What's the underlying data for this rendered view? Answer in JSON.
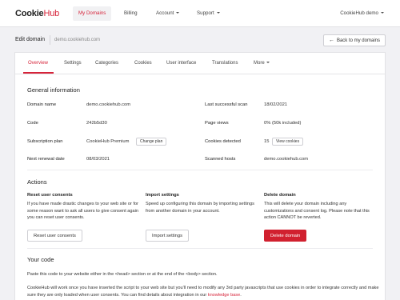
{
  "brand": {
    "part1": "Cookie",
    "part2": "Hub"
  },
  "nav": {
    "my_domains": "My Domains",
    "billing": "Billing",
    "account": "Account",
    "support": "Support",
    "user": "CookieHub demo"
  },
  "subheader": {
    "title": "Edit domain",
    "domain": "demo.cookiehub.com",
    "back_label": "Back to my domains"
  },
  "tabs": [
    "Overview",
    "Settings",
    "Categories",
    "Cookies",
    "User interface",
    "Translations",
    "More"
  ],
  "general": {
    "title": "General information",
    "domain_name_label": "Domain name",
    "domain_name": "demo.cookiehub.com",
    "code_label": "Code",
    "code": "242b5d30",
    "plan_label": "Subscription plan",
    "plan": "CookieHub Premium",
    "change_plan": "Change plan",
    "renewal_label": "Next renewal date",
    "renewal": "08/03/2021",
    "last_scan_label": "Last successful scan",
    "last_scan": "18/02/2021",
    "page_views_label": "Page views",
    "page_views": "0% (50k included)",
    "cookies_detected_label": "Cookies detected",
    "cookies_detected": "15",
    "view_cookies": "View cookies",
    "scanned_hosts_label": "Scanned hosts",
    "scanned_hosts": "demo.cookiehub.com"
  },
  "actions": {
    "title": "Actions",
    "reset": {
      "heading": "Reset user consents",
      "text": "If you have made drastic changes to your web site or for some reason want to ask all users to give consent again you can reset user consents.",
      "button": "Reset user consents"
    },
    "import": {
      "heading": "Import settings",
      "text": "Speed up configuring this domain by importing settings from another domain in your account.",
      "button": "Import settings"
    },
    "delete": {
      "heading": "Delete domain",
      "text": "This will delete your domain including any customizations and consent log. Please note that this action CANNOT be reverted.",
      "button": "Delete domain"
    }
  },
  "your_code": {
    "title": "Your code",
    "para1": "Paste this code to your website either in the <head> section or at the end of the <body> section.",
    "para2": "CookieHub will work once you have inserted the script to your web site but you'll need to modify any 3rd party javascripts that use cookies in order to integrate correctly and make sure they are only loaded when user consents. You can find details about integration in our ",
    "link": "knowledge base",
    "para2_end": "."
  }
}
